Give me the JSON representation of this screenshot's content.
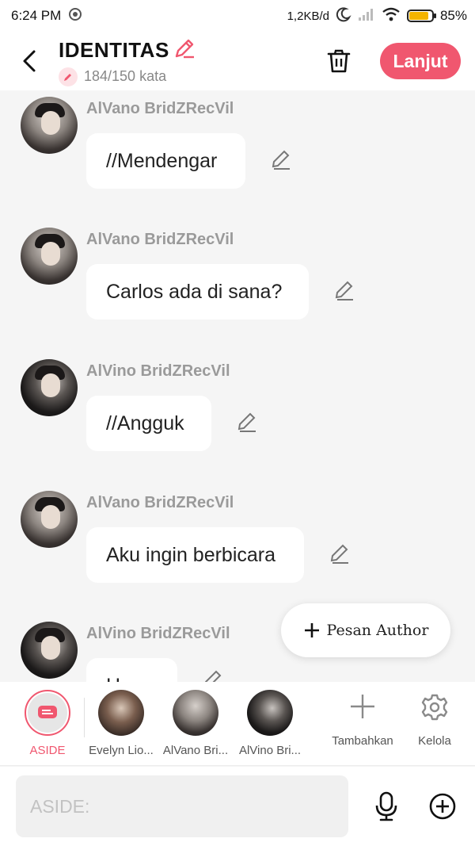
{
  "status_bar": {
    "time": "6:24 PM",
    "network_speed": "1,2KB/d",
    "battery": "85%",
    "battery_level": 0.85
  },
  "header": {
    "title": "IDENTITAS",
    "word_count": "184/150 kata",
    "next_label": "Lanjut"
  },
  "messages": [
    {
      "sender": "AlVano BridZRecVil",
      "text": "//Mendengar"
    },
    {
      "sender": "AlVano BridZRecVil",
      "text": "Carlos ada di sana?"
    },
    {
      "sender": "AlVino BridZRecVil",
      "text": "//Angguk"
    },
    {
      "sender": "AlVano BridZRecVil",
      "text": "Aku ingin berbicara"
    },
    {
      "sender": "AlVino BridZRecVil",
      "text": "H..."
    }
  ],
  "author_button": {
    "label": "Pesan Author"
  },
  "characters": {
    "aside": "ASIDE",
    "items": [
      "Evelyn Lio...",
      "AlVano Bri...",
      "AlVino Bri..."
    ],
    "add_label": "Tambahkan",
    "manage_label": "Kelola"
  },
  "input": {
    "placeholder": "ASIDE:"
  },
  "colors": {
    "accent": "#f0576f",
    "background": "#f5f5f5"
  }
}
